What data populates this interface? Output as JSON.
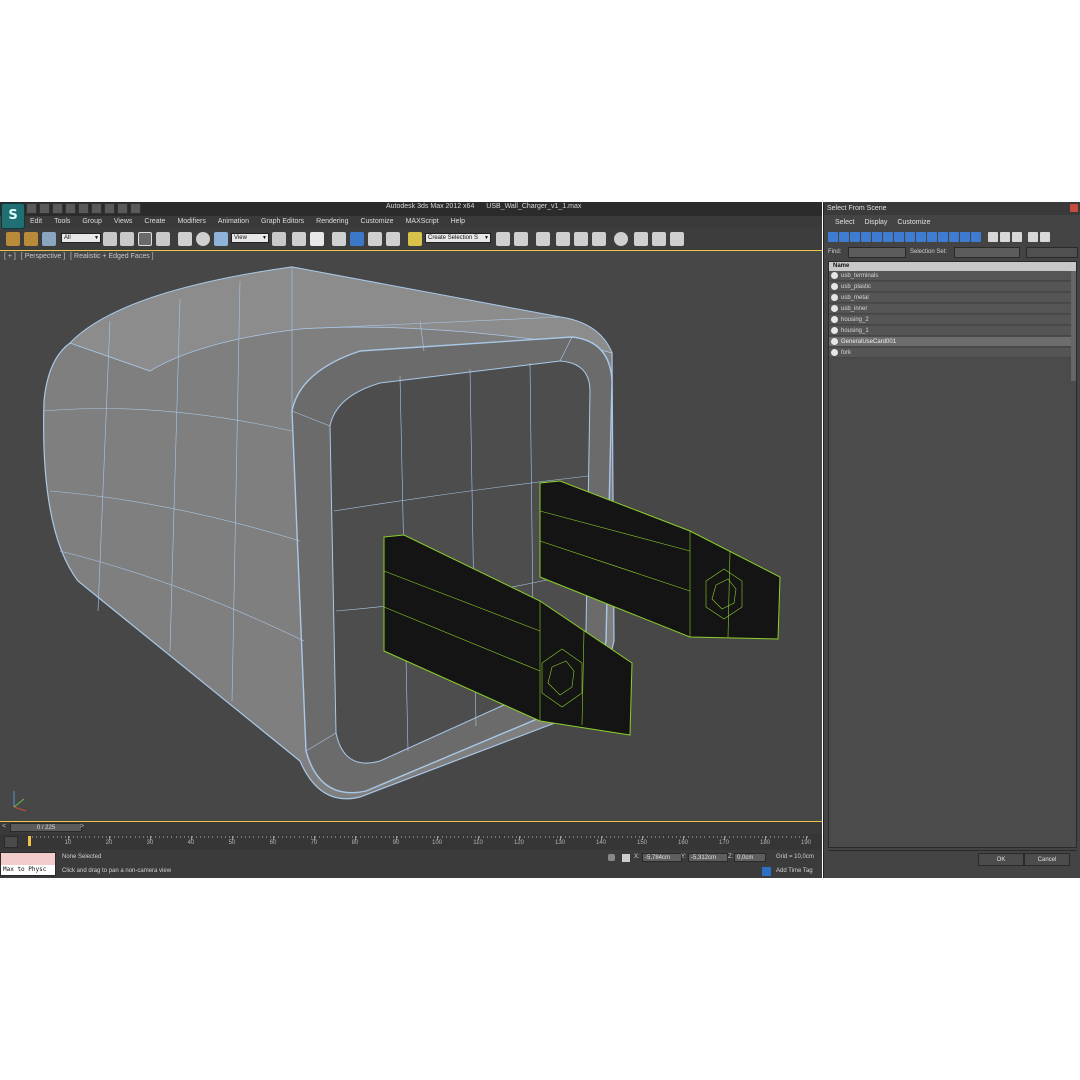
{
  "window": {
    "app_name": "Autodesk 3ds Max  2012 x64",
    "file_name": "USB_Wall_Charger_v1_1.max",
    "logo_glyph": "S"
  },
  "menu": [
    "Edit",
    "Tools",
    "Group",
    "Views",
    "Create",
    "Modifiers",
    "Animation",
    "Graph Editors",
    "Rendering",
    "Customize",
    "MAXScript",
    "Help"
  ],
  "toolbar": {
    "selection_filter": "All",
    "ref_coord_system": "View",
    "named_selection": "Create Selection S"
  },
  "viewport": {
    "labels": [
      "[ + ]",
      "[ Perspective ]",
      "[ Realistic + Edged Faces ]"
    ]
  },
  "timeline": {
    "frame_readout": "0 / 225",
    "prev_glyph": "<",
    "next_glyph": ">",
    "ruler_labels": [
      "10",
      "20",
      "30",
      "40",
      "50",
      "60",
      "70",
      "80",
      "90",
      "100",
      "110",
      "120",
      "130",
      "140",
      "150",
      "160",
      "170",
      "180",
      "190"
    ]
  },
  "status": {
    "listener_output": "Max to Physc",
    "selection_status": "None Selected",
    "prompt": "Click and drag to pan a non-camera view",
    "x_label": "X:",
    "x_value": "-5,784cm",
    "y_label": "Y:",
    "y_value": "-5,312cm",
    "z_label": "Z:",
    "z_value": "0,0cm",
    "grid": "Grid = 10,0cm",
    "add_time_tag": "Add Time Tag"
  },
  "dialog": {
    "title": "Select From Scene",
    "menu": [
      "Select",
      "Display",
      "Customize"
    ],
    "find_label": "Find:",
    "selection_set_label": "Selection Set:",
    "column_name": "Name",
    "objects": [
      {
        "name": "usb_terminals",
        "selected": false
      },
      {
        "name": "usb_plastic",
        "selected": false
      },
      {
        "name": "usb_metal",
        "selected": false
      },
      {
        "name": "usb_inner",
        "selected": false
      },
      {
        "name": "housing_2",
        "selected": false
      },
      {
        "name": "housing_1",
        "selected": false
      },
      {
        "name": "GeneralUseCard001",
        "selected": true
      },
      {
        "name": "fork",
        "selected": false
      }
    ],
    "ok_label": "OK",
    "cancel_label": "Cancel"
  },
  "colors": {
    "viewport_bg": "#474747",
    "active_viewport_border": "#f0c34a",
    "wire_blue": "#a9c8e8",
    "wire_green": "#8ccf2a",
    "prong_fill": "#141414"
  }
}
